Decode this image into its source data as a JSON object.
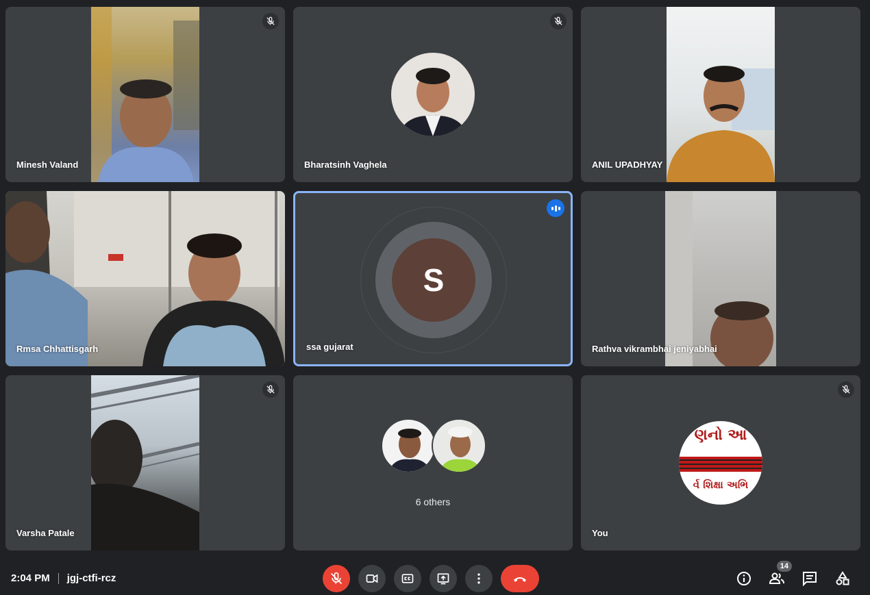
{
  "participants": [
    {
      "name": "Minesh Valand",
      "muted": true
    },
    {
      "name": "Bharatsinh Vaghela",
      "muted": true
    },
    {
      "name": "ANIL UPADHYAY",
      "muted": false
    },
    {
      "name": "Rmsa Chhattisgarh",
      "muted": false
    },
    {
      "name": "ssa gujarat",
      "muted": false,
      "speaking": true,
      "initial": "S",
      "avatar_color": "#5d4037"
    },
    {
      "name": "Rathva vikrambhai jeniyabhai",
      "muted": false
    },
    {
      "name": "Varsha Patale",
      "muted": true
    },
    {
      "others_label": "6 others"
    },
    {
      "name": "You",
      "muted": true,
      "avatar_text_top": "ણનો આ",
      "avatar_text_bottom": "ર્વ શિક્ષા અભિ"
    }
  ],
  "toolbar": {
    "time": "2:04 PM",
    "meeting_code": "jgj-ctfi-rcz",
    "people_count": "14"
  },
  "colors": {
    "background": "#202124",
    "tile": "#3c4043",
    "danger": "#ea4335",
    "accent": "#8ab4f8",
    "speaking": "#1a73e8"
  },
  "icons": [
    "mic-off-icon",
    "camera-icon",
    "captions-icon",
    "present-icon",
    "more-icon",
    "end-call-icon",
    "info-icon",
    "people-icon",
    "chat-icon",
    "activities-icon",
    "speaking-indicator-icon"
  ]
}
